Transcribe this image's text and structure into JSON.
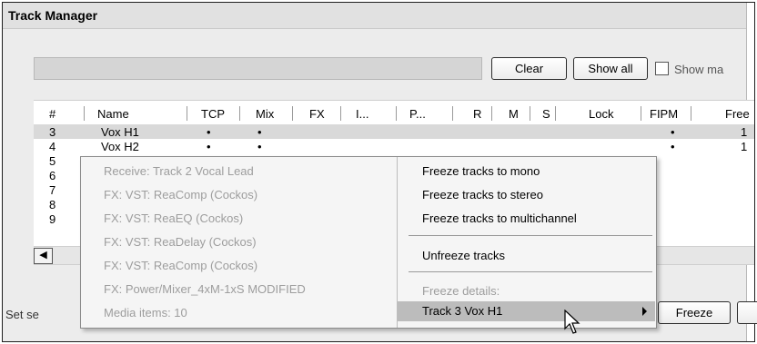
{
  "window": {
    "title": "Track Manager"
  },
  "toolbar": {
    "clear_label": "Clear",
    "show_all_label": "Show all",
    "show_ma_label": "Show ma"
  },
  "table": {
    "columns": [
      "#",
      "Name",
      "TCP",
      "Mix",
      "FX",
      "I...",
      "P...",
      "R",
      "M",
      "S",
      "Lock",
      "FIPM",
      "Free"
    ],
    "rows": [
      {
        "num": "3",
        "name": "Vox H1",
        "tcp": "•",
        "mix": "•",
        "fipm": "•",
        "free": "1"
      },
      {
        "num": "4",
        "name": "Vox H2",
        "tcp": "•",
        "mix": "•",
        "fipm": "•",
        "free": "1"
      },
      {
        "num": "5"
      },
      {
        "num": "6"
      },
      {
        "num": "7"
      },
      {
        "num": "8"
      },
      {
        "num": "9"
      }
    ]
  },
  "status": {
    "text": "Set se"
  },
  "bottom": {
    "freeze_label": "Freeze"
  },
  "context_menu": {
    "info_items": [
      "Receive: Track 2 Vocal Lead",
      "FX: VST: ReaComp (Cockos)",
      "FX: VST: ReaEQ (Cockos)",
      "FX: VST: ReaDelay (Cockos)",
      "FX: VST: ReaComp (Cockos)",
      "FX: Power/Mixer_4xM-1xS MODIFIED",
      "Media items: 10"
    ],
    "items": [
      "Freeze tracks to mono",
      "Freeze tracks to stereo",
      "Freeze tracks to multichannel",
      "Unfreeze tracks"
    ],
    "details_label": "Freeze details:",
    "submenu_label": "Track 3 Vox H1"
  },
  "icons": {
    "scroll_left": "scroll-left-arrow-icon",
    "submenu": "submenu-arrow-icon",
    "cursor": "mouse-cursor-icon"
  }
}
